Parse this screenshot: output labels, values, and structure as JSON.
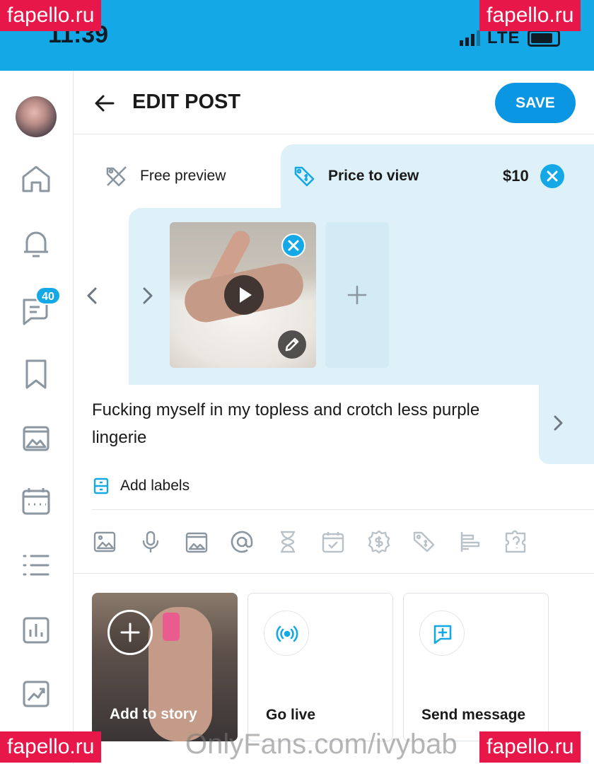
{
  "status_bar": {
    "time": "11:39",
    "network": "LTE"
  },
  "watermark": {
    "badge": "fapello.ru",
    "footer": "OnlyFans.com/ivybab"
  },
  "sidebar": {
    "items": [
      {
        "name": "home",
        "icon": "home-icon"
      },
      {
        "name": "notifications",
        "icon": "bell-icon"
      },
      {
        "name": "messages",
        "icon": "message-icon",
        "badge": "40"
      },
      {
        "name": "bookmarks",
        "icon": "bookmark-icon"
      },
      {
        "name": "vault",
        "icon": "media-icon"
      },
      {
        "name": "queue",
        "icon": "calendar-icon"
      },
      {
        "name": "lists",
        "icon": "list-icon"
      },
      {
        "name": "statements",
        "icon": "chart-icon"
      },
      {
        "name": "statistics",
        "icon": "trend-icon"
      }
    ]
  },
  "header": {
    "title": "EDIT POST",
    "save_label": "SAVE"
  },
  "pricing": {
    "free_preview_label": "Free preview",
    "price_to_view_label": "Price to view",
    "price": "$10"
  },
  "post": {
    "caption": "Fucking myself in my topless and crotch less purple lingerie",
    "add_labels": "Add labels"
  },
  "toolbar": {
    "tools": [
      "image-icon",
      "microphone-icon",
      "vault-icon",
      "mention-icon",
      "hourglass-icon",
      "schedule-icon",
      "tip-icon",
      "price-tag-icon",
      "poll-icon",
      "quiz-icon"
    ]
  },
  "cards": {
    "story": "Add to story",
    "live": "Go live",
    "message": "Send message"
  },
  "colors": {
    "accent": "#15a8e6",
    "button": "#0b96e3",
    "panel": "#dff1f8",
    "icon_gray": "#8a96a0"
  }
}
